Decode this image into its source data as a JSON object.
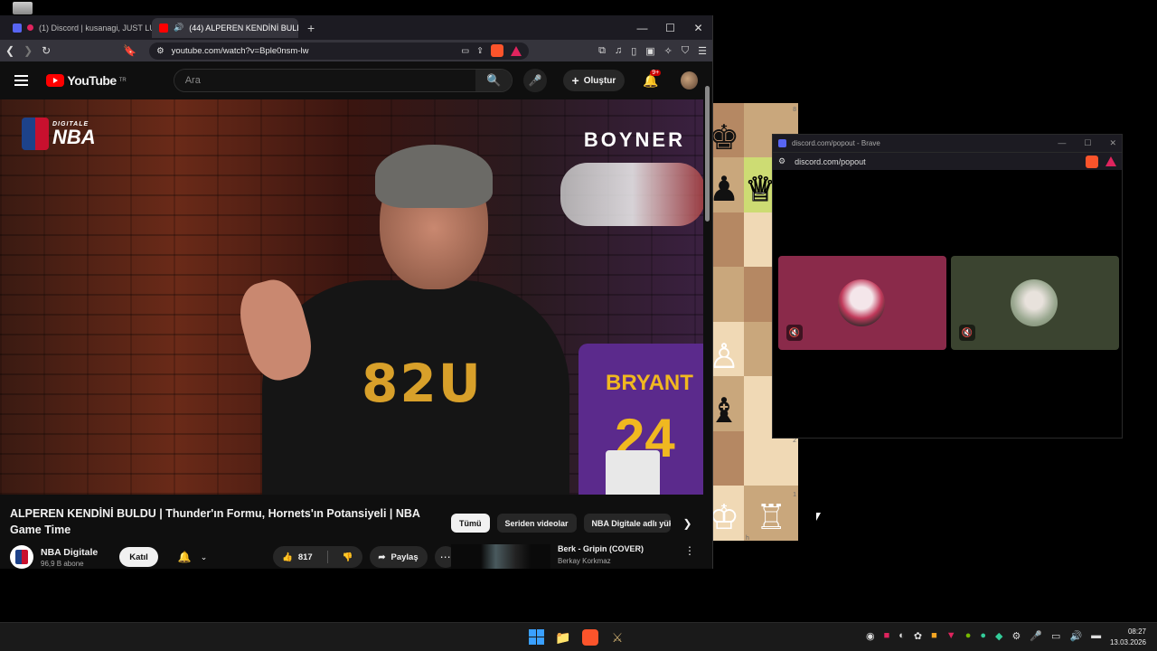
{
  "browser": {
    "tabs": [
      {
        "label": "(1) Discord | kusanagi, JUST LUX.",
        "active": false
      },
      {
        "label": "(44) ALPEREN KENDİNİ BULD",
        "active": true
      }
    ],
    "new_tab": "+",
    "window_controls": [
      "—",
      "☐",
      "✕"
    ],
    "url": "youtube.com/watch?v=Bple0nsm-lw"
  },
  "youtube": {
    "logo_text": "YouTube",
    "region": "TR",
    "search_placeholder": "Ara",
    "create_label": "Oluştur",
    "notification_count": "9+",
    "video": {
      "overlay_logo": "NBA",
      "overlay_logo_small": "DIGITALE",
      "sponsor": "BOYNER",
      "shirt_print": "82U",
      "jersey_name": "BRYANT",
      "jersey_number": "24"
    },
    "title": "ALPEREN KENDİNİ BULDU | Thunder'ın Formu, Hornets'ın Potansiyeli | NBA Game Time",
    "channel": {
      "name": "NBA Digitale",
      "subscribers": "96,9 B abone",
      "join_label": "Katıl"
    },
    "likes": "817",
    "share_label": "Paylaş",
    "chips": [
      "Tümü",
      "Seriden videolar",
      "NBA Digitale adlı yükl"
    ],
    "recommendation": {
      "title": "Berk - Gripin (COVER)",
      "channel": "Berkay Korkmaz"
    }
  },
  "chess": {
    "rank_top": "8",
    "rank_bottom": "1",
    "rank_mid": "2",
    "file_h": "h"
  },
  "discord_popout": {
    "window_title": "discord.com/popout - Brave",
    "url": "discord.com/popout",
    "tiles": [
      {
        "color": "#8a2a4a"
      },
      {
        "color": "#3b4430"
      }
    ]
  },
  "taskbar": {
    "time": "08:27",
    "date": "13.03.2026"
  }
}
